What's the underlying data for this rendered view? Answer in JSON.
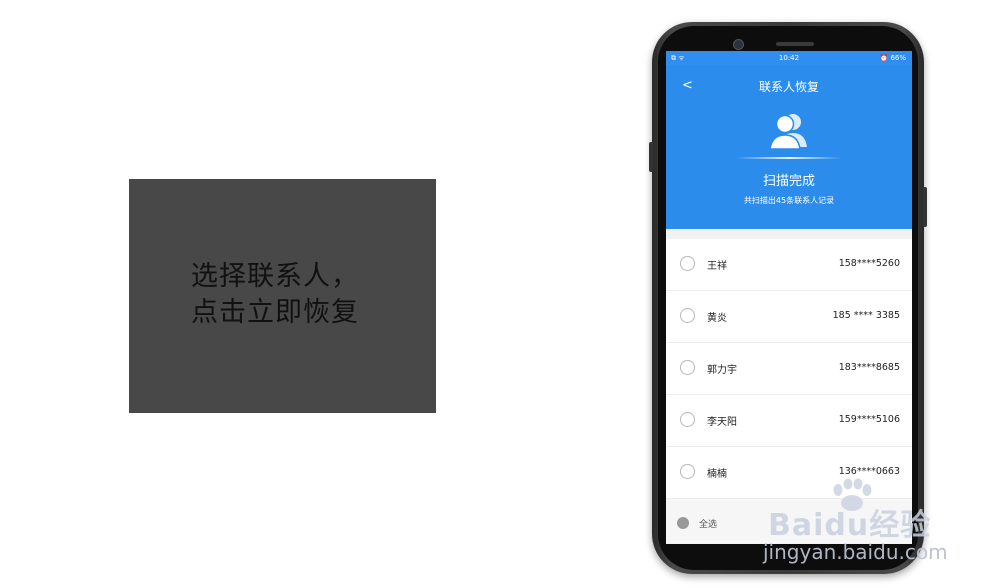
{
  "caption": {
    "line1": "选择联系人，",
    "line2": "点击立即恢复"
  },
  "status_bar": {
    "time": "10:42",
    "battery": "66%",
    "left_icons": "⧉ ᯤ",
    "right_icons": "⏰ 66%"
  },
  "header": {
    "back_icon": "<",
    "title": "联系人恢复",
    "scan_status": "扫描完成",
    "scan_summary": "共扫描出45条联系人记录",
    "avatar_icon": "contacts-icon"
  },
  "contacts": [
    {
      "name": "王祥",
      "phone": "158****5260"
    },
    {
      "name": "黄炎",
      "phone": "185 **** 3385"
    },
    {
      "name": "郭力宇",
      "phone": "183****8685"
    },
    {
      "name": "李天阳",
      "phone": "159****5106"
    },
    {
      "name": "楠楠",
      "phone": "136****0663"
    }
  ],
  "footer": {
    "select_all_label": "全选"
  },
  "watermark": {
    "logo_text": "Baidu经验",
    "url": "jingyan.baidu.com"
  },
  "colors": {
    "header_blue": "#2b8ceb",
    "caption_bg": "#484848"
  }
}
